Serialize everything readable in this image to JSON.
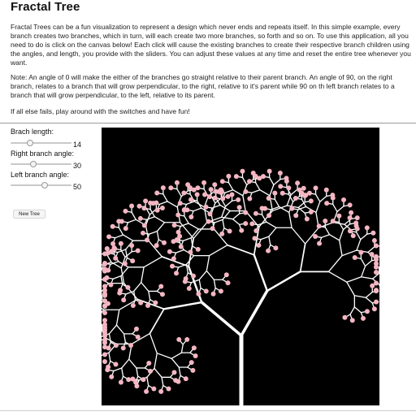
{
  "page": {
    "title": "Fractal Tree",
    "paragraphs": [
      "Fractal Trees can be a fun visualization to represent a design which never ends and repeats itself. In this simple example, every branch creates two branches, which in turn, will each create two more branches, so forth and so on. To use this application, all you need to do is click on the canvas below! Each click will cause the existing branches to create their respective branch children using the angles, and length, you provide with the sliders. You can adjust these values at any time and reset the entire tree whenever you want.",
      "Note: An angle of 0 will make the either of the branches go straight relative to their parent branch. An angle of 90, on the right branch, relates to a branch that will grow perpendicular, to the right, relative to it's parent while 90 on th left branch relates to a branch that will grow perpendicular, to the left, relative to its parent.",
      "If all else fails, play around with the switches and have fun!"
    ]
  },
  "controls": {
    "branch_length": {
      "label": "Brach length:",
      "value": "14"
    },
    "right_angle": {
      "label": "Right branch angle:",
      "value": "30"
    },
    "left_angle": {
      "label": "Left branch angle:",
      "value": "50"
    },
    "new_tree_button": "New Tree"
  },
  "canvas": {
    "background": "#000000",
    "branch_color": "#ffffff",
    "blossom_color": "#f4b6c2"
  }
}
